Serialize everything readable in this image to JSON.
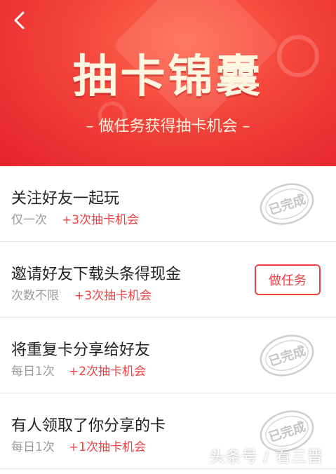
{
  "header": {
    "back_icon": "chevron-left-icon",
    "title": "抽卡锦囊",
    "subtitle": "– 做任务获得抽卡机会 –"
  },
  "tasks": [
    {
      "name": "关注好友一起玩",
      "frequency": "仅一次",
      "reward": "+3次抽卡机会",
      "status": "已完成"
    },
    {
      "name": "邀请好友下载头条得现金",
      "frequency": "次数不限",
      "reward": "+3次抽卡机会",
      "action": "做任务"
    },
    {
      "name": "将重复卡分享给好友",
      "frequency": "每日1次",
      "reward": "+2次抽卡机会",
      "status": "已完成"
    },
    {
      "name": "有人领取了你分享的卡",
      "frequency": "每日1次",
      "reward": "+1次抽卡机会",
      "status": "已完成"
    }
  ],
  "watermark": "头条号 / 看三晋",
  "colors": {
    "accent": "#f04142",
    "header": "#e3232d",
    "title": "#fff6e1"
  }
}
